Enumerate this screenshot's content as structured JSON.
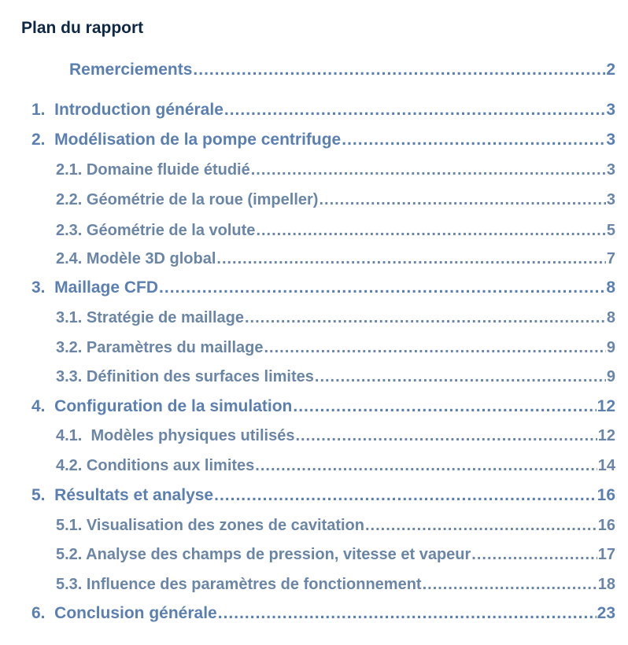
{
  "document": {
    "title": "Plan du rapport"
  },
  "toc": [
    {
      "level": 0,
      "label": "Remerciements",
      "page": "2"
    },
    {
      "level": 1,
      "label": "1.  Introduction générale",
      "page": "3"
    },
    {
      "level": 1,
      "label": "2.  Modélisation de la pompe centrifuge",
      "page": "3"
    },
    {
      "level": 2,
      "label": "2.1. Domaine fluide étudié",
      "page": "3"
    },
    {
      "level": 2,
      "label": "2.2. Géométrie de la roue (impeller)",
      "page": "3"
    },
    {
      "level": 2,
      "label": "2.3. Géométrie de la volute",
      "page": "5"
    },
    {
      "level": 2,
      "label": "2.4. Modèle 3D global",
      "page": "7"
    },
    {
      "level": 1,
      "label": "3.  Maillage CFD",
      "page": "8"
    },
    {
      "level": 2,
      "label": "3.1. Stratégie de maillage",
      "page": "8"
    },
    {
      "level": 2,
      "label": "3.2. Paramètres du maillage",
      "page": "9"
    },
    {
      "level": 2,
      "label": "3.3. Définition des surfaces limites",
      "page": "9"
    },
    {
      "level": 1,
      "label": "4.  Configuration de la simulation",
      "page": "12"
    },
    {
      "level": 2,
      "label": "4.1.  Modèles physiques utilisés",
      "page": "12"
    },
    {
      "level": 2,
      "label": "4.2. Conditions aux limites",
      "page": "14"
    },
    {
      "level": 1,
      "label": "5.  Résultats et analyse",
      "page": "16"
    },
    {
      "level": 2,
      "label": "5.1. Visualisation des zones de cavitation",
      "page": "16"
    },
    {
      "level": 2,
      "label": "5.2. Analyse des champs de pression, vitesse et vapeur",
      "page": "17"
    },
    {
      "level": 2,
      "label": "5.3. Influence des paramètres de fonctionnement",
      "page": "18"
    },
    {
      "level": 1,
      "label": "6.  Conclusion générale",
      "page": "23"
    }
  ]
}
